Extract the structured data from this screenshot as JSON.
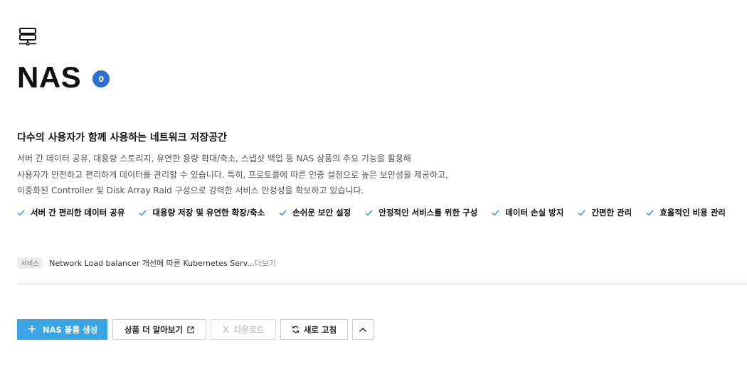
{
  "product": {
    "icon": "server-icon",
    "title": "NAS",
    "count": "0"
  },
  "intro": {
    "subtitle": "다수의 사용자가 함께 사용하는 네트워크 저장공간",
    "description": [
      "서버 간 데이터 공유, 대용량 스토리지, 유연한 용량 확대/축소, 스냅샷 백업 등 NAS 상품의 주요 기능을 활용해",
      "사용자가 안전하고 편리하게 데이터를 관리할 수 있습니다. 특히, 프로토콜에 따른 인증 설정으로 높은 보안성을 제공하고,",
      "이중화된 Controller 및 Disk Array Raid 구성으로 강력한 서비스 안정성을 확보하고 있습니다."
    ]
  },
  "features": [
    "서버 간 편리한 데이터 공유",
    "대용량 저장 및 유연한 확장/축소",
    "손쉬운 보안 설정",
    "안정적인 서비스를 위한 구성",
    "데이터 손실 방지",
    "간편한 관리",
    "효율적인 비용 관리"
  ],
  "notice": {
    "badge": "서비스",
    "text": "Network Load balancer 개선에 따른 Kubernetes Serv...",
    "more": "더보기"
  },
  "toolbar": {
    "create_label": "NAS 볼륨 생성",
    "learn_label": "상품 더 알아보기",
    "download_label": "다운로드",
    "refresh_label": "새로 고침"
  },
  "colors": {
    "primary": "#3aa5e5",
    "badge": "#2d6fd6",
    "check": "#2a8fd6"
  }
}
